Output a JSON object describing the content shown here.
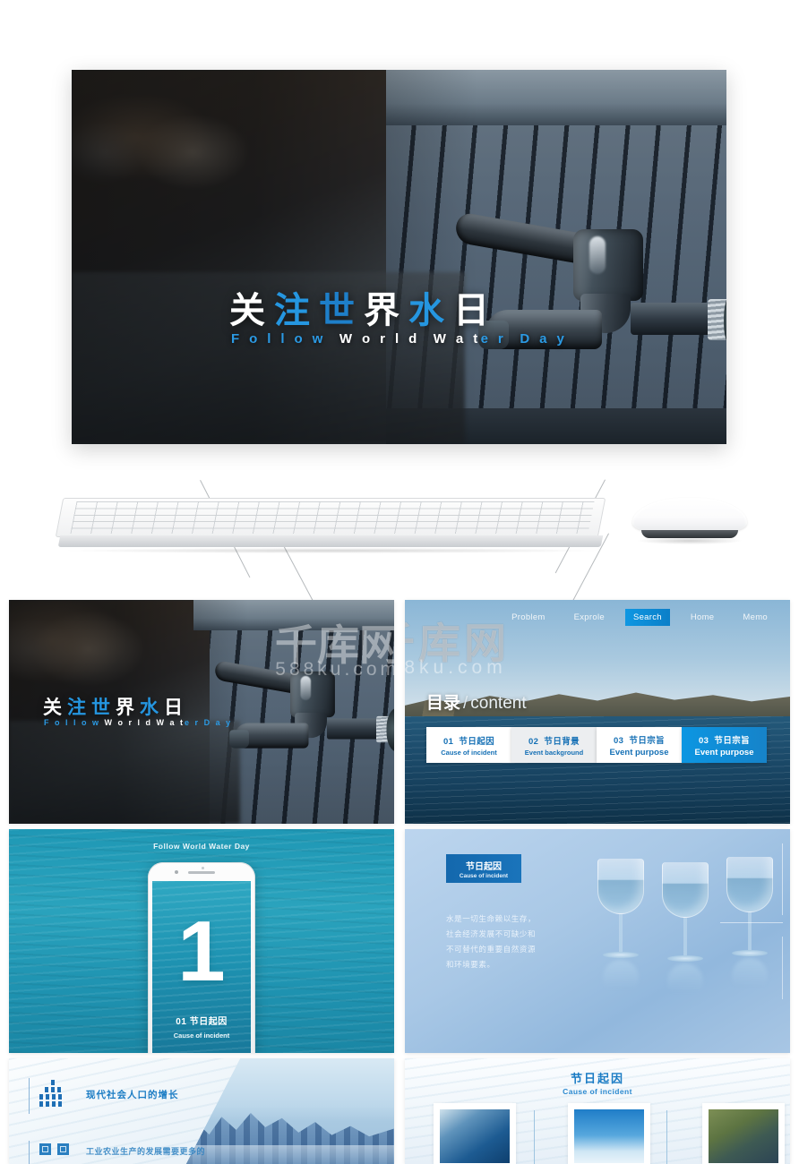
{
  "hero": {
    "title_chars": [
      {
        "t": "关",
        "c": "white"
      },
      {
        "t": "注",
        "c": "blue"
      },
      {
        "t": "世",
        "c": "blue2"
      },
      {
        "t": "界",
        "c": "white"
      },
      {
        "t": "水",
        "c": "blue"
      },
      {
        "t": "日",
        "c": "white"
      }
    ],
    "title_plain": "关注世界水日",
    "subtitle_words": [
      {
        "t": "Follow",
        "c": "blue"
      },
      {
        "t": "World",
        "c": "white"
      },
      {
        "t": "Wat",
        "c": "white"
      },
      {
        "t": "er",
        "c": "blue"
      },
      {
        "t": "Day",
        "c": "blue"
      }
    ],
    "subtitle_plain": "Follow World Water Day"
  },
  "slide_title": {
    "title_plain": "关注世界水日",
    "subtitle_plain": "Follow World Water Day"
  },
  "slide_content": {
    "nav": [
      {
        "label": "Problem",
        "active": false
      },
      {
        "label": "Exprole",
        "active": false
      },
      {
        "label": "Search",
        "active": true
      },
      {
        "label": "Home",
        "active": false
      },
      {
        "label": "Memo",
        "active": false
      }
    ],
    "heading_cn": "目录",
    "heading_slash": "/",
    "heading_en": "content",
    "tabs": [
      {
        "num": "01",
        "cn": "节日起因",
        "en": "Cause of incident",
        "style": "white"
      },
      {
        "num": "02",
        "cn": "节日背景",
        "en": "Event background",
        "style": "grey"
      },
      {
        "num": "03",
        "cn": "节日宗旨",
        "en": "Event purpose",
        "style": "white-big"
      },
      {
        "num": "03",
        "cn": "节日宗旨",
        "en": "Event purpose",
        "style": "active"
      }
    ]
  },
  "slide_phone": {
    "caption": "Follow World Water Day",
    "number": "1",
    "label_cn": "01  节日起因",
    "label_en": "Cause of incident"
  },
  "slide_glass": {
    "badge_cn": "节日起因",
    "badge_en": "Cause of incident",
    "paragraph_lines": [
      "水是一切生命赖以生存，",
      "社会经济发展不可缺少和",
      "不可替代的重要自然资源",
      "和环境要素。"
    ]
  },
  "slide_population": {
    "label_main": "现代社会人口的增长",
    "label_second": "工业农业生产的发展需要更多的"
  },
  "slide_cause": {
    "title_cn": "节日起因",
    "title_en": "Cause of incident",
    "cards": [
      "water-wave-photo",
      "sky-bird-photo",
      "polluted-pond-photo"
    ]
  },
  "watermark": {
    "cn": "千库网",
    "en": "588ku.com"
  },
  "devices": {
    "keyboard": "keyboard-mockup",
    "mouse": "mouse-mockup"
  },
  "colors": {
    "accent_blue": "#1b7cc4",
    "bright_blue": "#0c96e2",
    "title_blue": "#2596e0",
    "teal": "#1f98b5",
    "dark": "#2c3339"
  }
}
